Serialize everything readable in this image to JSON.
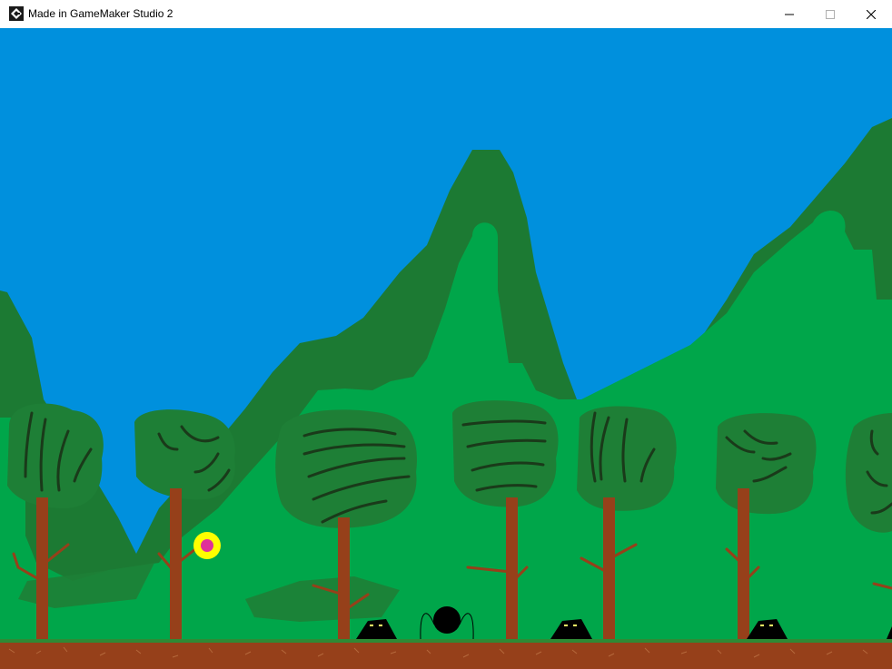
{
  "window": {
    "title": "Made in GameMaker Studio 2",
    "app_icon": "gamemaker-icon",
    "controls": [
      "minimize-icon",
      "maximize-icon",
      "close-icon"
    ]
  },
  "game": {
    "scene": "forest-level",
    "colors": {
      "sky": "#0090dd",
      "mountain_dark": "#1c7a33",
      "bush_light": "#00a64a",
      "canopy_dark": "#1e7f36",
      "trunk": "#96401a",
      "dirt": "#96401a",
      "coin_outer": "#ffff00",
      "coin_inner": "#e0309a",
      "enemy": "#000000",
      "enemy_eyes": "#ffff66"
    },
    "entities": {
      "player": "black-ball-with-legs",
      "enemies": 4,
      "pickups": 1
    }
  }
}
